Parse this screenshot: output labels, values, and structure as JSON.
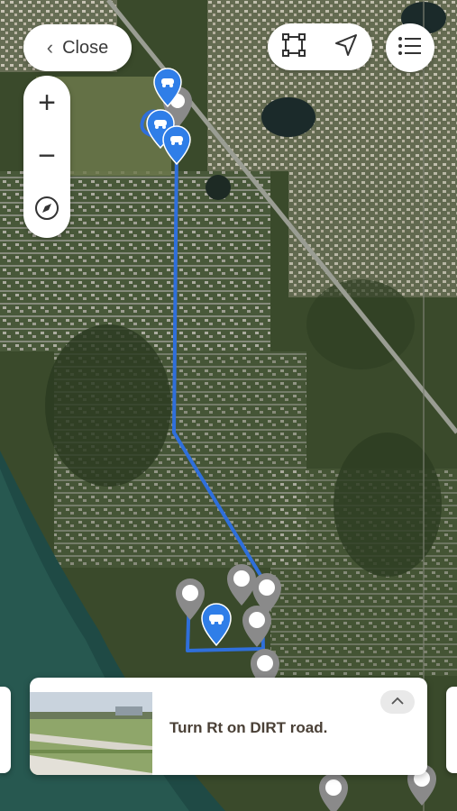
{
  "controls": {
    "close_label": "Close",
    "zoom_in": "+",
    "zoom_out": "−"
  },
  "icons": {
    "close": "chevron-left-icon",
    "area": "square-selection-icon",
    "locate": "navigation-arrow-icon",
    "list": "list-icon",
    "compass": "compass-icon",
    "collapse": "chevron-up-icon",
    "waypoint_car": "car-icon",
    "waypoint_gray": "map-pin-icon"
  },
  "colors": {
    "route": "#2f6fdb",
    "pin_active": "#2f7ee8",
    "pin_inactive": "#8a8a8a",
    "water": "#1f4a45",
    "land": "#3b4a2c"
  },
  "card": {
    "instruction": "Turn Rt on DIRT road."
  }
}
